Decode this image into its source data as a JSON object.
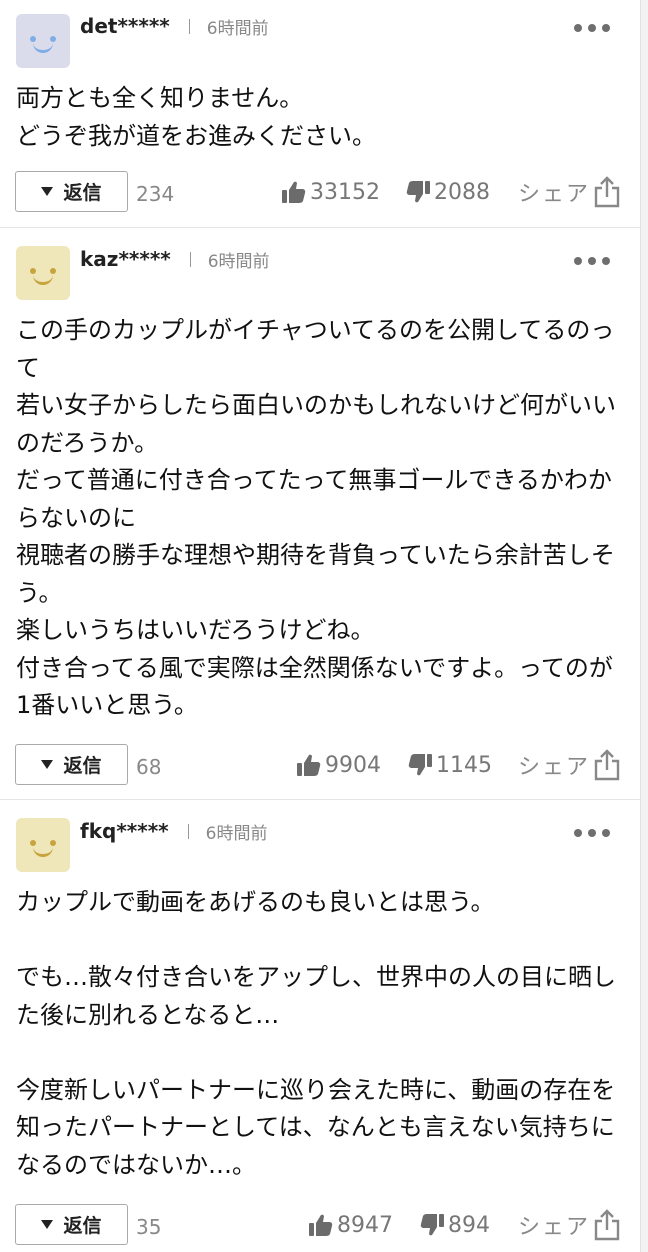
{
  "labels": {
    "reply": "返信",
    "share": "シェア"
  },
  "comments": [
    {
      "username": "det*****",
      "time": "6時間前",
      "text": "両方とも全く知りません。\nどうぞ我が道をお進みください。",
      "replies": "234",
      "likes": "33152",
      "dislikes": "2088",
      "avatar_color": "#dadbeb",
      "avatar_face_color": "#7faee6"
    },
    {
      "username": "kaz*****",
      "time": "6時間前",
      "text": "この手のカップルがイチャついてるのを公開してるのって\n若い女子からしたら面白いのかもしれないけど何がいいのだろうか。\nだって普通に付き合ってたって無事ゴールできるかわからないのに\n視聴者の勝手な理想や期待を背負っていたら余計苦しそう。\n楽しいうちはいいだろうけどね。\n付き合ってる風で実際は全然関係ないですよ。ってのが1番いいと思う。",
      "replies": "68",
      "likes": "9904",
      "dislikes": "1145",
      "avatar_color": "#efe6b9",
      "avatar_face_color": "#c7a43e"
    },
    {
      "username": "fkq*****",
      "time": "6時間前",
      "text": "カップルで動画をあげるのも良いとは思う。\n\nでも…散々付き合いをアップし、世界中の人の目に晒した後に別れるとなると…\n\n今度新しいパートナーに巡り会えた時に、動画の存在を知ったパートナーとしては、なんとも言えない気持ちになるのではないか…。",
      "replies": "35",
      "likes": "8947",
      "dislikes": "894",
      "avatar_color": "#efe6b9",
      "avatar_face_color": "#c7a43e"
    }
  ]
}
